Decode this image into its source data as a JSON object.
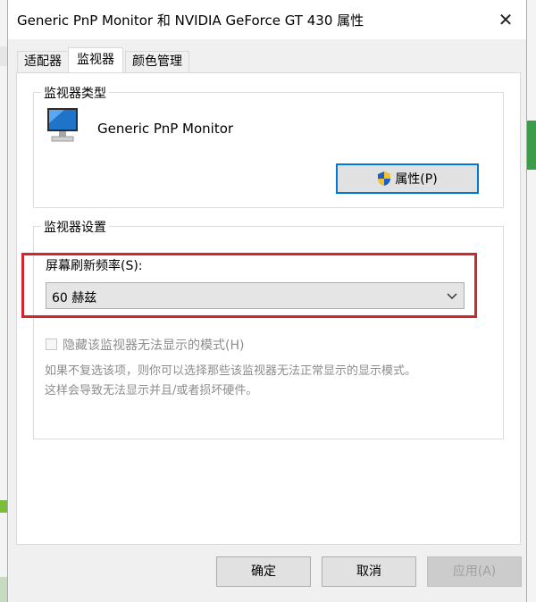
{
  "window": {
    "title": "Generic PnP Monitor 和 NVIDIA GeForce GT 430 属性",
    "close_glyph": "✕"
  },
  "tabs": [
    {
      "label": "适配器",
      "active": false
    },
    {
      "label": "监视器",
      "active": true
    },
    {
      "label": "颜色管理",
      "active": false
    }
  ],
  "monitor_type": {
    "group_title": "监视器类型",
    "icon": "monitor-icon",
    "name": "Generic PnP Monitor",
    "properties_button": "属性(P)",
    "properties_icon": "uac-shield-icon"
  },
  "monitor_settings": {
    "group_title": "监视器设置",
    "refresh_rate_label": "屏幕刷新频率(S):",
    "refresh_rate_value": "60 赫兹",
    "hide_modes_label": "隐藏该监视器无法显示的模式(H)",
    "hide_modes_checked": false,
    "hint_line1": "如果不复选该项，则你可以选择那些该监视器无法正常显示的显示模式。",
    "hint_line2": "这样会导致无法显示并且/或者损坏硬件。"
  },
  "buttons": {
    "ok": "确定",
    "cancel": "取消",
    "apply": "应用(A)"
  },
  "colors": {
    "highlight_border": "#d0262d",
    "focus_border": "#0078d7"
  }
}
